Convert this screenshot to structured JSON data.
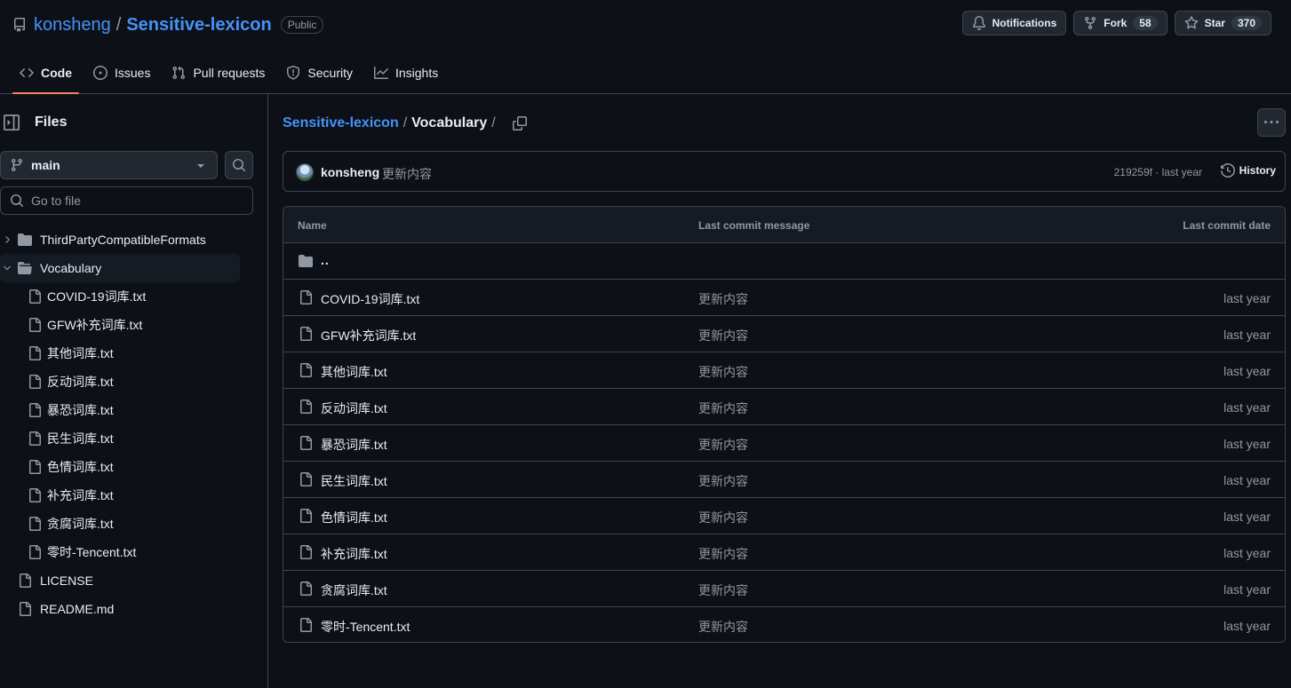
{
  "repo": {
    "owner": "konsheng",
    "separator": "/",
    "name": "Sensitive-lexicon",
    "visibility": "Public"
  },
  "actions": {
    "notifications_label": "Notifications",
    "fork_label": "Fork",
    "fork_count": "58",
    "star_label": "Star",
    "star_count": "370"
  },
  "tabs": [
    {
      "label": "Code",
      "icon": "code-icon"
    },
    {
      "label": "Issues",
      "icon": "issue-opened-icon"
    },
    {
      "label": "Pull requests",
      "icon": "git-pull-request-icon"
    },
    {
      "label": "Security",
      "icon": "shield-icon"
    },
    {
      "label": "Insights",
      "icon": "graph-icon"
    }
  ],
  "sidebar": {
    "title": "Files",
    "branch": "main",
    "goto_placeholder": "Go to file",
    "tree": {
      "folder1": "ThirdPartyCompatibleFormats",
      "folder2": "Vocabulary",
      "files": [
        "COVID-19词库.txt",
        "GFW补充词库.txt",
        "其他词库.txt",
        "反动词库.txt",
        "暴恐词库.txt",
        "民生词库.txt",
        "色情词库.txt",
        "补充词库.txt",
        "贪腐词库.txt",
        "零时-Tencent.txt"
      ],
      "root_files": [
        "LICENSE",
        "README.md"
      ]
    }
  },
  "breadcrumb": {
    "root": "Sensitive-lexicon",
    "sep": "/",
    "current": "Vocabulary",
    "trail": "/"
  },
  "commit": {
    "author": "konsheng",
    "message": "更新内容",
    "meta": "219259f · last year",
    "history_label": "History"
  },
  "table": {
    "headers": {
      "name": "Name",
      "message": "Last commit message",
      "date": "Last commit date"
    },
    "parent": "..",
    "rows": [
      {
        "name": "COVID-19词库.txt",
        "message": "更新内容",
        "date": "last year"
      },
      {
        "name": "GFW补充词库.txt",
        "message": "更新内容",
        "date": "last year"
      },
      {
        "name": "其他词库.txt",
        "message": "更新内容",
        "date": "last year"
      },
      {
        "name": "反动词库.txt",
        "message": "更新内容",
        "date": "last year"
      },
      {
        "name": "暴恐词库.txt",
        "message": "更新内容",
        "date": "last year"
      },
      {
        "name": "民生词库.txt",
        "message": "更新内容",
        "date": "last year"
      },
      {
        "name": "色情词库.txt",
        "message": "更新内容",
        "date": "last year"
      },
      {
        "name": "补充词库.txt",
        "message": "更新内容",
        "date": "last year"
      },
      {
        "name": "贪腐词库.txt",
        "message": "更新内容",
        "date": "last year"
      },
      {
        "name": "零时-Tencent.txt",
        "message": "更新内容",
        "date": "last year"
      }
    ]
  },
  "colors": {
    "background": "#0d1117",
    "link": "#4493f8",
    "border": "#3d444d",
    "tab_underline": "#f78166"
  }
}
